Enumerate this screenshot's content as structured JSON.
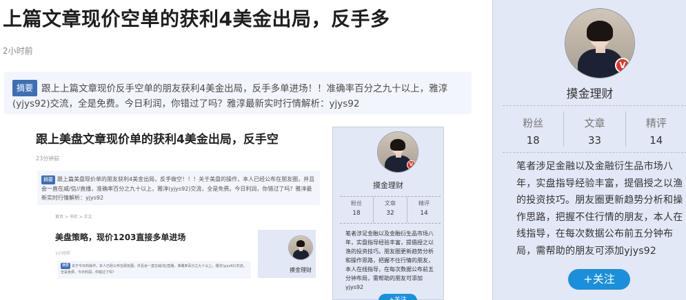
{
  "article": {
    "title": "上篇文章现价空单的获利4美金出局，反手多",
    "time": "2小时前",
    "summary_label": "摘要",
    "summary": "跟上上篇文章现价反手空单的朋友获利4美金出局，反手多单进场！！准确率百分之九十以上，雅淳(yjys92)交流，全是免费。今日利润，你错过了吗？雅淳最新实时行情解析：yjys92"
  },
  "embedded": {
    "title": "跟上美盘文章现价单的获利4美金出局，反手空",
    "time": "23分钟前",
    "summary_label": "摘要",
    "summary": "跟上篇美盘现价单的朋友获利4美金出局，反手做空！！！关于美盘的操作，本人已经公布在朋友圈，并且会一直在威/信//直播，准确率百分之九十以上，雅淳(yjys92)交流，全是免费。今日利润，你错过了吗？雅淳最新实时行情解析：yjys92",
    "breadcrumb": "首页 > 书社 > 正文",
    "sub_title": "美盘策略，现价1203直接多单进场",
    "sub_time": "1小时前",
    "sub_summary_label": "摘要",
    "sub_summary": "关于今日的操作，本人已经公布在朋友圈，并且会一直在威/信/直播，准确率百分之九十以上，雅淳(yjys92)交流，全是免费。今日利润，你错过了吗？",
    "mini_author": "摸金理财",
    "author": "摸金理财",
    "stats": [
      {
        "label": "粉丝",
        "value": "18"
      },
      {
        "label": "文章",
        "value": "32"
      },
      {
        "label": "精评",
        "value": "14"
      }
    ],
    "bio": "笔者涉足金融以及金融衍生品市场八年，实盘指导经验丰富，提倡授之以渔的投资技巧。朋友圈更新趋势分析和操作思路，把握不住行情的朋友，本人在线指导，在每次数据公布前五分钟布局，需帮助的朋友可添加yjys92",
    "follow_label": "+关注"
  },
  "sidebar": {
    "author": "摸金理财",
    "stats": [
      {
        "label": "粉丝",
        "value": "18"
      },
      {
        "label": "文章",
        "value": "33"
      },
      {
        "label": "精评",
        "value": "14"
      }
    ],
    "bio": "笔者涉足金融以及金融衍生品市场八年，实盘指导经验丰富，提倡授之以渔的投资技巧。朋友圈更新趋势分析和操作思路，把握不住行情的朋友，本人在线指导，在每次数据公布前五分钟布局，需帮助的朋友可添加yjys92",
    "follow_label": "+关注",
    "badge_icon": "verified-badge-icon"
  },
  "colors": {
    "accent": "#1a8fdc",
    "summary_badge": "#3d6fb6",
    "sidebar_bg": "#e3e8f6",
    "summary_bg": "#f3f5fc",
    "verified": "#e0352b"
  }
}
